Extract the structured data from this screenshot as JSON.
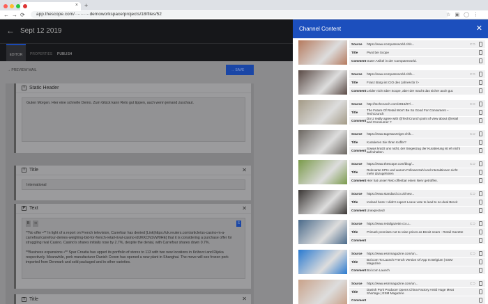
{
  "browser": {
    "url": "app.thescope.com/··········demoworkspace/projects/18/files/52",
    "tab_close": "×",
    "new_tab": "+"
  },
  "app": {
    "back": "←",
    "title": "Sept 12 2019",
    "tabs": [
      "EDITOR",
      "PROPERTIES",
      "PUBLISH"
    ],
    "preview": "→ PREVIEW MAIL",
    "save": "→   SAVE"
  },
  "cards": {
    "static_header": {
      "label": "Static Header",
      "icon": "T",
      "text": "Guten Morgen. Hier eine schnelle Demo. Zum Glück kann Reto gut tippen, auch wenn jemand zuschaut."
    },
    "title1": {
      "label": "Title",
      "icon": "T",
      "value": "International"
    },
    "text": {
      "label": "Text",
      "icon": "P",
      "toolbar": [
        "B",
        "∞"
      ],
      "s_btn": "S",
      "p1": "**No offer •** In light of a report on French television, Carrefour has denied [Link|https://uk.reuters.com/article/us-casino-m-a-carrefour/carrefour-denies-weighing-bid-for-french-retail-rival-casino-idUKKCN1VW0HE] that it is considering a purchase offer for struggling rival Casino. Casino's shares initially rose by 2.7%, despite the denial, with Carrefour shares down 0.7%.",
      "p2": "**Business expansions •** Spar Croatia has upped its portfolio of stores to 113 with two new locations in Križevci and Rijeka respectively. Meanwhile, pork manufacturer Danish Crown has opened a new plant in Shanghai. The move will see frozen pork imported from Denmark and sold packaged and in other varieties."
    },
    "title2": {
      "label": "Title",
      "icon": "T"
    },
    "close": "✕"
  },
  "panel": {
    "title": "Channel Content",
    "close": "✕",
    "labels": {
      "source": "Source",
      "title": "Title",
      "comment": "Comment"
    },
    "items": [
      {
        "source": "https://www.computerworld.ch/s...",
        "title": "Pivot bei Scope",
        "comment": "Guter Artikel in der Computerworld.",
        "img": "#b57a5e"
      },
      {
        "source": "https://www.computerworld.ch/b...",
        "title": "Franz Bürgi ist CIO des Jahres<br />",
        "comment": "Leider nicht über Scope, aber der macht das sicher auch gut.",
        "img": "#5a4a45"
      },
      {
        "source": "http://techcrunch.com/2015/07/...",
        "title": "The Future Of Retail Won't Be So Good For Consumers – TechCrunch",
        "comment": "Do U really agree with @TechCrunch point of view about @retail and #consumer ?",
        "img": "#a39a86"
      },
      {
        "source": "https://www.tagesanzeiger.ch/k...",
        "title": "Kuratieren Sie Ihren Koffer?",
        "comment": "Sowas kratzt uns nicht, der Siegeszug der Kuratierung ist eh nicht aufzuhalten.",
        "img": "#6b6660"
      },
      {
        "source": "https://www.thescope.com/blog/...",
        "title": "Relevante KPIs und warum Followerzahl und Interaktionen nicht mehr dazugehören",
        "comment": "Hier hat unser Reto offenbar einen Nerv getroffen.",
        "img": "#7a9a4a"
      },
      {
        "source": "https://www.standard.co.uk/new...",
        "title": "Iceland boss: I didn't expect Leave vote to lead to no-deal Brexit",
        "comment": "Unexpected!",
        "img": "#3a3634"
      },
      {
        "source": "https://www.retailgazette.co.u...",
        "title": "Primark promises not to raise prices as Brexit nears - Retail Gazette",
        "comment": "",
        "img": "#4a6a8a"
      },
      {
        "source": "https://www.esmmagazine.com/un...",
        "title": "Bol.com To Launch French Version Of App In Belgium | ESM Magazine",
        "comment": "Bol.com Launch",
        "img": "#2a7ad0"
      },
      {
        "source": "https://www.esmmagazine.com/un...",
        "title": "Danish Pork Producer Opens China Factory Amid Huge Meat Shortage | ESM Magazine",
        "comment": "",
        "img": "#c9a28a"
      }
    ]
  }
}
